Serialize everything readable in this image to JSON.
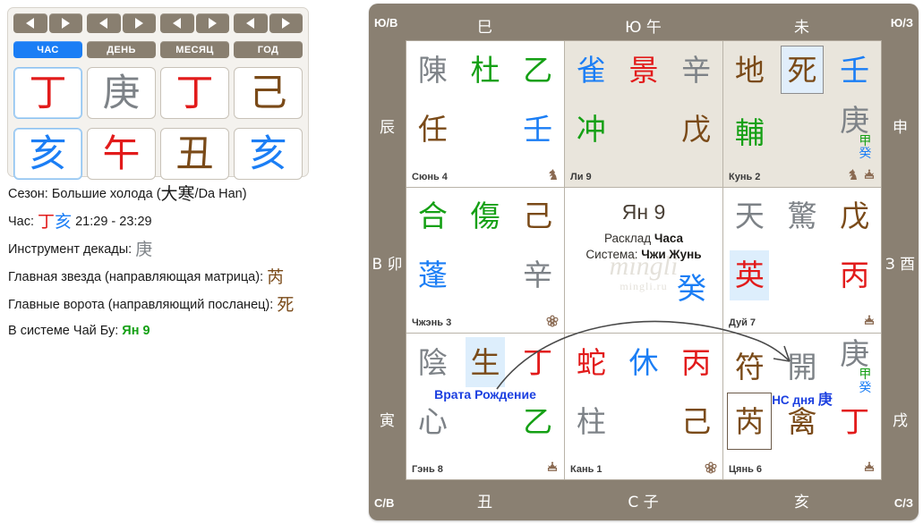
{
  "left_panel": {
    "pillars": [
      {
        "label": "ЧАС",
        "active": true,
        "stem": "丁",
        "stem_color": "#e21b1b",
        "branch": "亥",
        "branch_color": "#1b7ef5",
        "selected": true
      },
      {
        "label": "ДЕНЬ",
        "active": false,
        "stem": "庚",
        "stem_color": "#7d8287",
        "branch": "午",
        "branch_color": "#e21b1b",
        "selected": false
      },
      {
        "label": "МЕСЯЦ",
        "active": false,
        "stem": "丁",
        "stem_color": "#e21b1b",
        "branch": "丑",
        "branch_color": "#7a4a18",
        "selected": false
      },
      {
        "label": "ГОД",
        "active": false,
        "stem": "己",
        "stem_color": "#7a4a18",
        "branch": "亥",
        "branch_color": "#1b7ef5",
        "selected": false
      }
    ],
    "nav": {
      "prev_icon": "triangle-left-icon",
      "next_icon": "triangle-right-icon"
    },
    "info": {
      "season_label": "Сезон: Большие холода (",
      "season_cjk": "大寒",
      "season_suffix": "/Da Han)",
      "hour_label": "Час:",
      "hour_stem": "丁",
      "hour_branch": "亥",
      "hour_range": "21:29 - 23:29",
      "decade_label": "Инструмент декады:",
      "decade_value": "庚",
      "star_label": "Главная звезда (направляющая матрица):",
      "star_value": "芮",
      "gate_label": "Главные ворота (направляющий посланец):",
      "gate_value": "死",
      "chaibu_label": "В системе Чай Бу:",
      "chaibu_value": "Ян 9"
    }
  },
  "board": {
    "edges": {
      "corner_ne": "Ю/В",
      "corner_nw": "Ю/З",
      "corner_se": "С/В",
      "corner_sw": "С/З",
      "top": [
        "巳",
        "Ю 午",
        "未"
      ],
      "bottom": [
        "丑",
        "С 子",
        "亥"
      ],
      "left": [
        "辰",
        "В 卯",
        "寅"
      ],
      "right": [
        "申",
        "З 酉",
        "戌"
      ]
    },
    "center": {
      "title": "Ян 9",
      "sub_line1_a": "Расклад ",
      "sub_line1_b": "Часа",
      "sub_line2_a": "Система: ",
      "sub_line2_b": "Чжи Жунь",
      "corner_glyph": "癸",
      "watermark": "mingli",
      "watermark_sub": "mingli.ru"
    },
    "cells": [
      {
        "id": "sun-4",
        "palace": "Сюнь 4",
        "tan": false,
        "top": [
          {
            "ch": "陳",
            "color": "#7d8287"
          },
          {
            "ch": "杜",
            "color": "#15a015"
          },
          {
            "ch": "乙",
            "color": "#15a015"
          }
        ],
        "bottom": [
          {
            "ch": "任",
            "color": "#7a4a18"
          },
          {
            "ch": "",
            "color": ""
          },
          {
            "ch": "壬",
            "color": "#1b7ef5"
          }
        ],
        "icons": [
          "knight-icon"
        ]
      },
      {
        "id": "li-9",
        "palace": "Ли 9",
        "tan": true,
        "top": [
          {
            "ch": "雀",
            "color": "#1b7ef5"
          },
          {
            "ch": "景",
            "color": "#e21b1b"
          },
          {
            "ch": "辛",
            "color": "#7d8287"
          }
        ],
        "bottom": [
          {
            "ch": "冲",
            "color": "#15a015"
          },
          {
            "ch": "",
            "color": ""
          },
          {
            "ch": "戊",
            "color": "#7a4a18"
          }
        ],
        "icons": []
      },
      {
        "id": "kun-2",
        "palace": "Кунь 2",
        "tan": true,
        "top": [
          {
            "ch": "地",
            "color": "#7a4a18"
          },
          {
            "ch": "死",
            "color": "#7a4a18",
            "highlight": "box"
          },
          {
            "ch": "壬",
            "color": "#1b7ef5"
          }
        ],
        "bottom": [
          {
            "ch": "輔",
            "color": "#15a015"
          },
          {
            "ch": "",
            "color": ""
          },
          {
            "ch": "庚",
            "color": "#7d8287",
            "sup_top": "甲",
            "sup_top_color": "#15a015",
            "sup_bot": "癸",
            "sup_bot_color": "#1b7ef5"
          }
        ],
        "icons": [
          "knight-icon",
          "crown-icon"
        ]
      },
      {
        "id": "zhen-3",
        "palace": "Чжэнь 3",
        "tan": false,
        "top": [
          {
            "ch": "合",
            "color": "#15a015"
          },
          {
            "ch": "傷",
            "color": "#15a015"
          },
          {
            "ch": "己",
            "color": "#7a4a18"
          }
        ],
        "bottom": [
          {
            "ch": "蓬",
            "color": "#1b7ef5"
          },
          {
            "ch": "",
            "color": ""
          },
          {
            "ch": "辛",
            "color": "#7d8287"
          }
        ],
        "icons": [
          "flower-icon"
        ]
      },
      {
        "id": "center",
        "palace": "",
        "tan": false,
        "top": [],
        "bottom": [],
        "icons": []
      },
      {
        "id": "dui-7",
        "palace": "Дуй 7",
        "tan": false,
        "top": [
          {
            "ch": "天",
            "color": "#7d8287"
          },
          {
            "ch": "驚",
            "color": "#7d8287"
          },
          {
            "ch": "戊",
            "color": "#7a4a18"
          }
        ],
        "bottom": [
          {
            "ch": "英",
            "color": "#e21b1b",
            "highlight": "soft"
          },
          {
            "ch": "",
            "color": ""
          },
          {
            "ch": "丙",
            "color": "#e21b1b"
          }
        ],
        "icons": [
          "crown-icon"
        ]
      },
      {
        "id": "gen-8",
        "palace": "Гэнь 8",
        "tan": false,
        "top": [
          {
            "ch": "陰",
            "color": "#7d8287"
          },
          {
            "ch": "生",
            "color": "#7a4a18",
            "highlight": "soft"
          },
          {
            "ch": "丁",
            "color": "#e21b1b"
          }
        ],
        "bottom": [
          {
            "ch": "心",
            "color": "#7d8287"
          },
          {
            "ch": "",
            "color": ""
          },
          {
            "ch": "乙",
            "color": "#15a015"
          }
        ],
        "note": "Врата Рождение",
        "icons": [
          "crown-icon"
        ]
      },
      {
        "id": "kan-1",
        "palace": "Кань 1",
        "tan": false,
        "top": [
          {
            "ch": "蛇",
            "color": "#e21b1b"
          },
          {
            "ch": "休",
            "color": "#1b7ef5"
          },
          {
            "ch": "丙",
            "color": "#e21b1b"
          }
        ],
        "bottom": [
          {
            "ch": "柱",
            "color": "#7d8287"
          },
          {
            "ch": "",
            "color": ""
          },
          {
            "ch": "己",
            "color": "#7a4a18"
          }
        ],
        "icons": [
          "flower-icon"
        ]
      },
      {
        "id": "qian-6",
        "palace": "Цянь 6",
        "tan": false,
        "top": [
          {
            "ch": "符",
            "color": "#7a4a18"
          },
          {
            "ch": "開",
            "color": "#7d8287"
          },
          {
            "ch": "庚",
            "color": "#7d8287",
            "sup_top": "甲",
            "sup_top_color": "#15a015",
            "sup_bot": "癸",
            "sup_bot_color": "#1b7ef5"
          }
        ],
        "bottom": [
          {
            "ch": "芮",
            "color": "#7a4a18",
            "highlight": "boxed"
          },
          {
            "ch": "禽",
            "color": "#7a4a18"
          },
          {
            "ch": "丁",
            "color": "#e21b1b"
          }
        ],
        "note_hs_label": "НС дня",
        "note_hs_value": "庚",
        "icons": [
          "crown-icon"
        ]
      }
    ]
  }
}
